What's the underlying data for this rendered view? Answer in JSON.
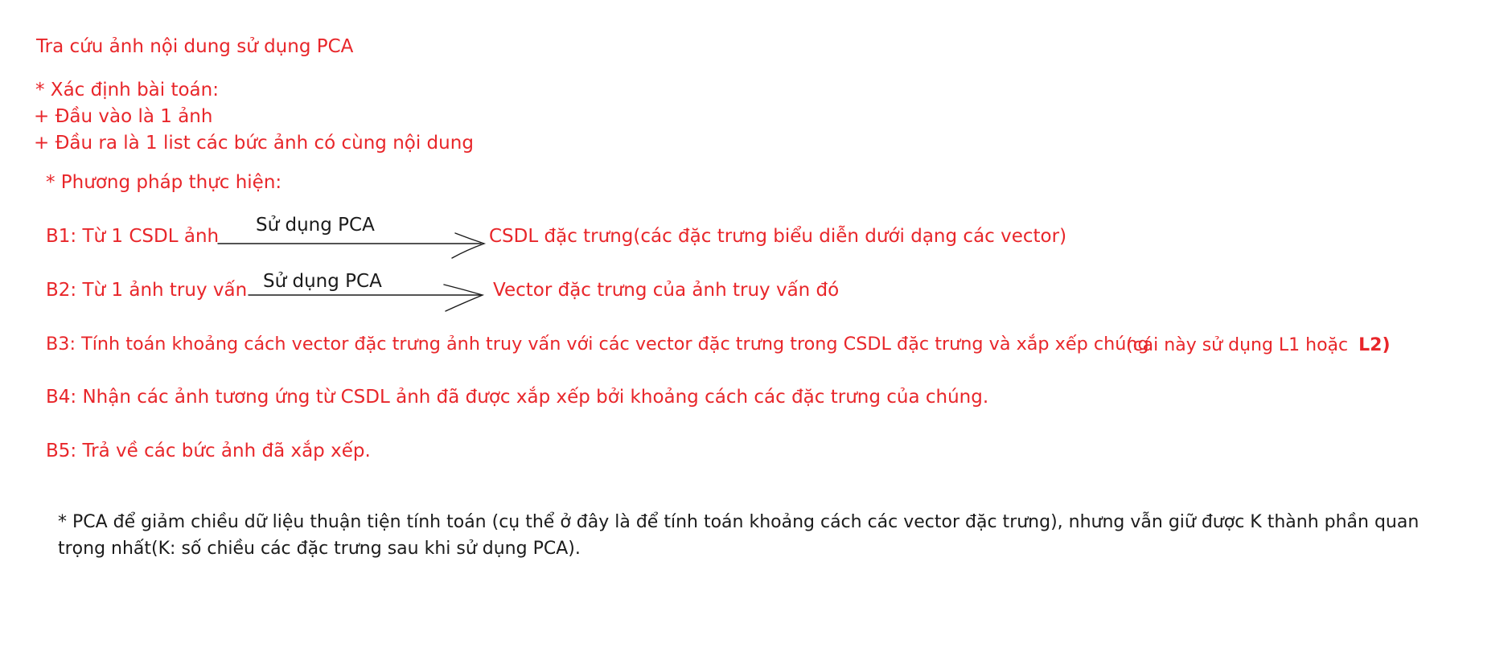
{
  "title": "Tra cứu ảnh nội dung sử dụng PCA",
  "problem": {
    "heading": "* Xác định bài toán:",
    "input": "+ Đầu vào là 1 ảnh",
    "output": "+ Đầu ra là 1 list các bức ảnh có cùng nội dung"
  },
  "method": {
    "heading": "* Phương pháp thực hiện:",
    "b1": {
      "label": "B1: Từ 1 CSDL ảnh",
      "arrow_text": "Sử dụng PCA",
      "result": "CSDL đặc trưng(các đặc trưng biểu diễn dưới dạng các vector)"
    },
    "b2": {
      "label": "B2: Từ 1 ảnh truy vấn",
      "arrow_text": "Sử dụng PCA",
      "result": "Vector đặc trưng của ảnh truy vấn đó"
    },
    "b3": {
      "text": "B3: Tính toán khoảng cách vector đặc trưng ảnh truy vấn với các vector đặc trưng trong CSDL đặc trưng và xắp xếp chúng",
      "note": "(cái này sử dụng L1 hoặc",
      "note_bold": "L2)"
    },
    "b4": "B4: Nhận các ảnh tương ứng từ CSDL ảnh đã được xắp xếp bởi khoảng cách các đặc trưng của chúng.",
    "b5": "B5: Trả về các bức ảnh đã xắp xếp."
  },
  "pca_note": {
    "line1": "* PCA để giảm chiều dữ liệu thuận tiện tính toán (cụ thể ở đây là để tính toán khoảng cách các vector đặc trưng), nhưng vẫn giữ được K thành phần quan",
    "line2": "trọng nhất(K: số chiều các đặc trưng sau khi sử dụng PCA)."
  }
}
